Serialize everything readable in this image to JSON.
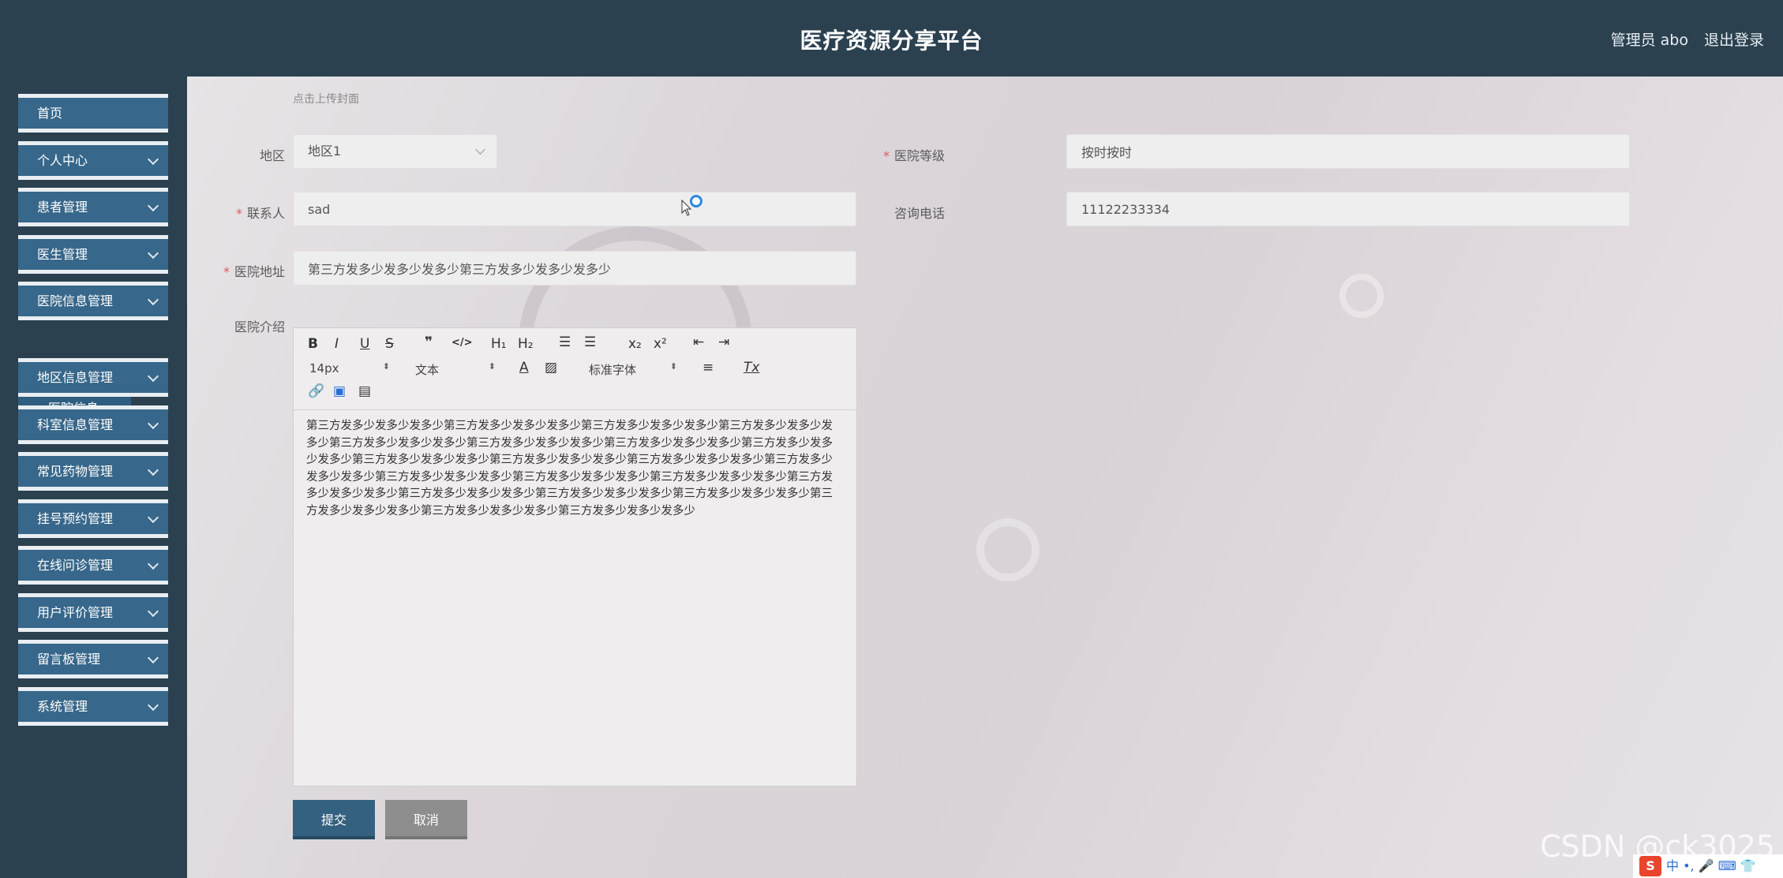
{
  "header": {
    "title": "医疗资源分享平台",
    "user": "管理员 abo",
    "logout": "退出登录"
  },
  "sidebar": {
    "items": [
      {
        "label": "首页",
        "expandable": false
      },
      {
        "label": "个人中心",
        "expandable": true
      },
      {
        "label": "患者管理",
        "expandable": true
      },
      {
        "label": "医生管理",
        "expandable": true
      },
      {
        "label": "医院信息管理",
        "expandable": true
      },
      {
        "label": "地区信息管理",
        "expandable": true
      },
      {
        "label": "科室信息管理",
        "expandable": true
      },
      {
        "label": "常见药物管理",
        "expandable": true
      },
      {
        "label": "挂号预约管理",
        "expandable": true
      },
      {
        "label": "在线问诊管理",
        "expandable": true
      },
      {
        "label": "用户评价管理",
        "expandable": true
      },
      {
        "label": "留言板管理",
        "expandable": true
      },
      {
        "label": "系统管理",
        "expandable": true
      }
    ],
    "subitem": "医院信息"
  },
  "form": {
    "cover_hint": "点击上传封面",
    "region_label": "地区",
    "region_value": "地区1",
    "level_label": "医院等级",
    "level_value": "按时按时",
    "contact_label": "联系人",
    "contact_value": "sad",
    "phone_label": "咨询电话",
    "phone_value": "11122233334",
    "address_label": "医院地址",
    "address_value": "第三方发多少发多少发多少第三方发多少发多少发多少",
    "intro_label": "医院介绍",
    "intro_content": "第三方发多少发多少发多少第三方发多少发多少发多少第三方发多少发多少发多少第三方发多少发多少发多少第三方发多少发多少发多少第三方发多少发多少发多少第三方发多少发多少发多少第三方发多少发多少发多少第三方发多少发多少发多少第三方发多少发多少发多少第三方发多少发多少发多少第三方发多少发多少发多少第三方发多少发多少发多少第三方发多少发多少发多少第三方发多少发多少发多少第三方发多少发多少发多少第三方发多少发多少发多少第三方发多少发多少发多少第三方发多少发多少发多少第三方发多少发多少发多少第三方发多少发多少发多少第三方发多少发多少发多少",
    "submit": "提交",
    "cancel": "取消"
  },
  "editor_toolbar": {
    "bold": "B",
    "italic": "I",
    "underline": "U",
    "strike": "S",
    "quote": "❞",
    "code": "</>",
    "h1": "H₁",
    "h2": "H₂",
    "subscript": "x₂",
    "superscript": "x²",
    "size": "14px",
    "header": "文本",
    "font": "标准字体",
    "clear": "Tx"
  },
  "overlay": {
    "watermark": "CSDN @ck3025",
    "ime": "中 •, 🎤 ⌨ 👕"
  },
  "theme": {
    "header_bg": "#2b4150",
    "nav_bg": "#37678a",
    "submit_bg": "#34617f",
    "cancel_bg": "#8e8e8e",
    "required": "#e05a5a"
  }
}
